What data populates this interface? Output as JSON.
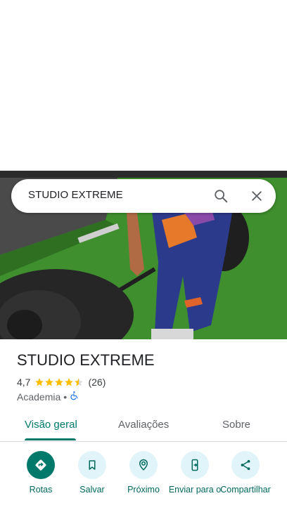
{
  "search": {
    "query": "STUDIO EXTREME"
  },
  "place": {
    "name": "STUDIO EXTREME",
    "rating": "4,7",
    "stars": 4.7,
    "review_count": "(26)",
    "category": "Academia",
    "separator": "•"
  },
  "tabs": [
    {
      "label": "Visão geral"
    },
    {
      "label": "Avaliações"
    },
    {
      "label": "Sobre"
    }
  ],
  "actions": [
    {
      "label": "Rotas",
      "icon": "directions-icon"
    },
    {
      "label": "Salvar",
      "icon": "bookmark-icon"
    },
    {
      "label": "Próximo",
      "icon": "nearby-icon"
    },
    {
      "label": "Enviar para o",
      "icon": "send-to-phone-icon"
    },
    {
      "label": "Compartilhar",
      "icon": "share-icon"
    }
  ],
  "colors": {
    "accent": "#00796b",
    "star": "#fbbc04",
    "action_bg": "#e0f4f9"
  }
}
